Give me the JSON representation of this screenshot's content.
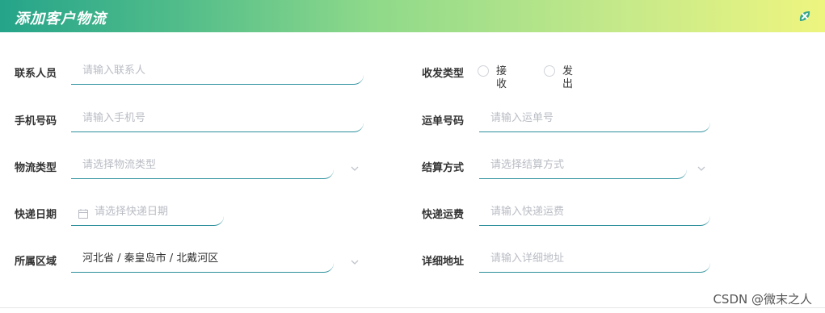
{
  "dialog": {
    "title": "添加客户物流"
  },
  "form": {
    "contact_person": {
      "label": "联系人员",
      "placeholder": "请输入联系人"
    },
    "direction": {
      "label": "收发类型",
      "options": [
        "接收",
        "发出"
      ]
    },
    "phone": {
      "label": "手机号码",
      "placeholder": "请输入手机号"
    },
    "waybill": {
      "label": "运单号码",
      "placeholder": "请输入运单号"
    },
    "logistics_type": {
      "label": "物流类型",
      "placeholder": "请选择物流类型"
    },
    "settlement": {
      "label": "结算方式",
      "placeholder": "请选择结算方式"
    },
    "express_date": {
      "label": "快递日期",
      "placeholder": "请选择快递日期"
    },
    "express_fee": {
      "label": "快递运费",
      "placeholder": "请输入快递运费"
    },
    "region": {
      "label": "所属区域",
      "value": "河北省 / 秦皇岛市 / 北戴河区"
    },
    "address": {
      "label": "详细地址",
      "placeholder": "请输入详细地址"
    }
  },
  "watermark": "CSDN @微末之人",
  "icons": {
    "close": "close-icon",
    "calendar": "calendar-icon",
    "chevron": "chevron-down-icon"
  },
  "colors": {
    "accent": "#2b8f9c",
    "title_text": "#ffffff"
  }
}
